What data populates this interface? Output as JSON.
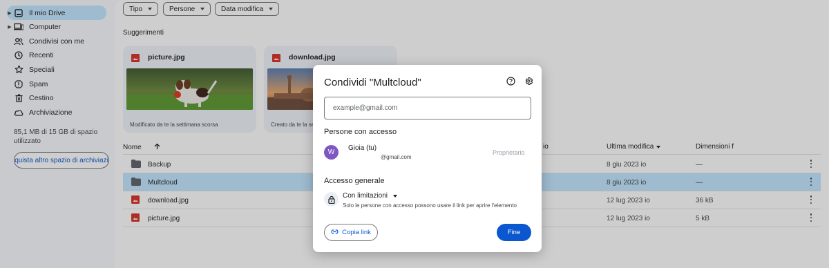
{
  "sidebar": {
    "items": [
      {
        "label": "Il mio Drive",
        "icon": "my-drive-icon"
      },
      {
        "label": "Computer",
        "icon": "computer-icon"
      },
      {
        "label": "Condivisi con me",
        "icon": "shared-icon"
      },
      {
        "label": "Recenti",
        "icon": "clock-icon"
      },
      {
        "label": "Speciali",
        "icon": "star-icon"
      },
      {
        "label": "Spam",
        "icon": "spam-icon"
      },
      {
        "label": "Cestino",
        "icon": "trash-icon"
      },
      {
        "label": "Archiviazione",
        "icon": "cloud-icon"
      }
    ],
    "storage_text": "85,1 MB di 15 GB di spazio utilizzato",
    "buy_button": "quista altro spazio di archiviazi"
  },
  "filters": [
    "Tipo",
    "Persone",
    "Data modifica"
  ],
  "suggestions": {
    "title": "Suggerimenti",
    "cards": [
      {
        "name": "picture.jpg",
        "subtitle": "Modificato da te la settimana scorsa"
      },
      {
        "name": "download.jpg",
        "subtitle": "Creato da te la se"
      }
    ]
  },
  "table": {
    "headers": {
      "name": "Nome",
      "owner_partial": "io",
      "modified": "Ultima modifica",
      "size": "Dimensioni f"
    },
    "rows": [
      {
        "name": "Backup",
        "type": "folder",
        "modified": "8 giu 2023",
        "owner": "io",
        "size": "—"
      },
      {
        "name": "Multcloud",
        "type": "folder",
        "modified": "8 giu 2023",
        "owner": "io",
        "size": "—"
      },
      {
        "name": "download.jpg",
        "type": "image",
        "modified": "12 lug 2023",
        "owner": "io",
        "size": "36 kB"
      },
      {
        "name": "picture.jpg",
        "type": "image",
        "modified": "12 lug 2023",
        "owner": "io",
        "size": "5 kB"
      }
    ]
  },
  "dialog": {
    "title": "Condividi \"Multcloud\"",
    "input_placeholder": "example@gmail.com",
    "people_heading": "Persone con accesso",
    "person": {
      "initial": "W",
      "name": "Gioia (tu)",
      "email": "@gmail.com",
      "role": "Proprietario"
    },
    "general_heading": "Accesso generale",
    "access_value": "Con limitazioni",
    "access_desc": "Solo le persone con accesso possono usare il link per aprire l'elemento",
    "copy_link": "Copia link",
    "done": "Fine"
  },
  "colors": {
    "accent": "#0b57d0",
    "selected": "#c2e7ff",
    "image_icon": "#d93025",
    "folder_icon": "#5f6368",
    "avatar": "#7e57c2"
  }
}
